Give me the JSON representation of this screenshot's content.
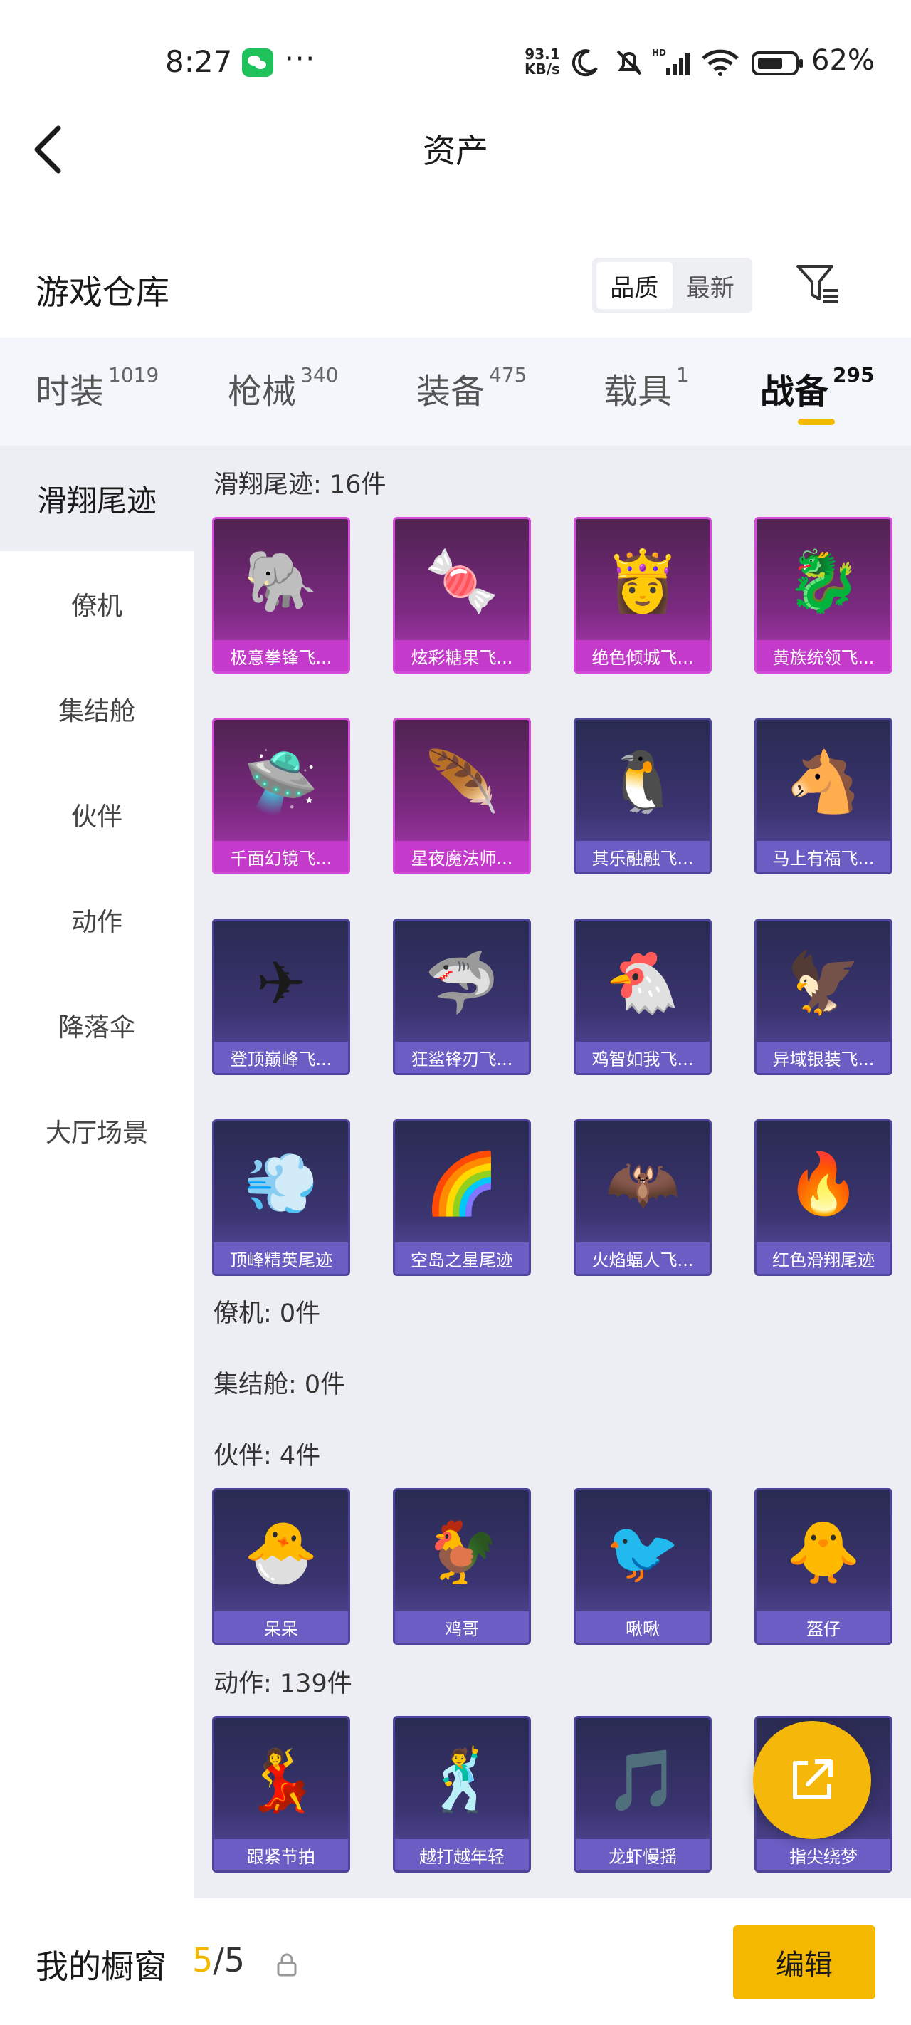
{
  "status_bar": {
    "time": "8:27",
    "net_speed_value": "93.1",
    "net_speed_unit": "KB/s",
    "battery": "62%",
    "icons": [
      "wechat-icon",
      "more-dots-icon",
      "moon-icon",
      "mute-bell-icon",
      "hd-signal-icon",
      "wifi-icon",
      "battery-icon"
    ]
  },
  "header": {
    "title": "资产"
  },
  "warehouse": {
    "title": "游戏仓库",
    "sort_options": [
      "品质",
      "最新"
    ],
    "active_sort": "品质"
  },
  "tabs": [
    {
      "label": "时装",
      "count": "1019"
    },
    {
      "label": "枪械",
      "count": "340"
    },
    {
      "label": "装备",
      "count": "475"
    },
    {
      "label": "载具",
      "count": "1"
    },
    {
      "label": "战备",
      "count": "295"
    }
  ],
  "active_tab": "战备",
  "side_nav": [
    {
      "label": "滑翔尾迹"
    },
    {
      "label": "僚机"
    },
    {
      "label": "集结舱"
    },
    {
      "label": "伙伴"
    },
    {
      "label": "动作"
    },
    {
      "label": "降落伞"
    },
    {
      "label": "大厅场景"
    }
  ],
  "active_side": "滑翔尾迹",
  "groups": {
    "glide": {
      "label": "滑翔尾迹: 16件",
      "items": [
        {
          "name": "极意拳锋飞...",
          "tier": "purple",
          "icon": "elephant-rider-icon"
        },
        {
          "name": "炫彩糖果飞...",
          "tier": "purple",
          "icon": "candy-icon"
        },
        {
          "name": "绝色倾城飞...",
          "tier": "purple",
          "icon": "beauty-icon"
        },
        {
          "name": "黄族统领飞...",
          "tier": "purple",
          "icon": "dragon-icon"
        },
        {
          "name": "千面幻镜飞...",
          "tier": "purple",
          "icon": "ufo-icon"
        },
        {
          "name": "星夜魔法师...",
          "tier": "purple",
          "icon": "feather-wing-icon"
        },
        {
          "name": "其乐融融飞...",
          "tier": "blue",
          "icon": "penguin-icon"
        },
        {
          "name": "马上有福飞...",
          "tier": "blue",
          "icon": "horse-icon"
        },
        {
          "name": "登顶巅峰飞...",
          "tier": "blue",
          "icon": "jet-icon"
        },
        {
          "name": "狂鲨锋刃飞...",
          "tier": "blue",
          "icon": "shark-icon"
        },
        {
          "name": "鸡智如我飞...",
          "tier": "blue",
          "icon": "chicken-icon"
        },
        {
          "name": "异域银装飞...",
          "tier": "blue",
          "icon": "mecha-wing-icon"
        },
        {
          "name": "顶峰精英尾迹",
          "tier": "blue",
          "icon": "smoke-trail-icon"
        },
        {
          "name": "空岛之星尾迹",
          "tier": "blue",
          "icon": "rainbow-trail-icon"
        },
        {
          "name": "火焰蝠人飞...",
          "tier": "blue",
          "icon": "bat-hero-icon"
        },
        {
          "name": "红色滑翔尾迹",
          "tier": "blue",
          "icon": "red-trail-icon"
        }
      ]
    },
    "wingman": {
      "label": "僚机: 0件"
    },
    "pod": {
      "label": "集结舱: 0件"
    },
    "partner": {
      "label": "伙伴: 4件",
      "items": [
        {
          "name": "呆呆",
          "tier": "blue",
          "icon": "chick-icon"
        },
        {
          "name": "鸡哥",
          "tier": "blue",
          "icon": "rooster-icon"
        },
        {
          "name": "啾啾",
          "tier": "blue",
          "icon": "pink-bird-icon"
        },
        {
          "name": "盔仔",
          "tier": "blue",
          "icon": "helmet-chick-icon"
        }
      ]
    },
    "emote": {
      "label": "动作: 139件",
      "items": [
        {
          "name": "跟紧节拍",
          "tier": "blue",
          "icon": "dance-pose-icon"
        },
        {
          "name": "越打越年轻",
          "tier": "blue",
          "icon": "dance-music-icon"
        },
        {
          "name": "龙虾慢摇",
          "tier": "blue",
          "icon": "dance-sway-icon"
        },
        {
          "name": "指尖绕梦",
          "tier": "blue",
          "icon": "dance-finger-icon"
        }
      ]
    }
  },
  "showcase": {
    "label": "我的橱窗",
    "current": "5",
    "separator": "/",
    "total": "5",
    "edit_label": "编辑"
  },
  "colors": {
    "accent": "#f5b800",
    "purple_tier": "#c43bcc",
    "blue_tier": "#6a5ec4",
    "content_bg": "#eceef3"
  }
}
